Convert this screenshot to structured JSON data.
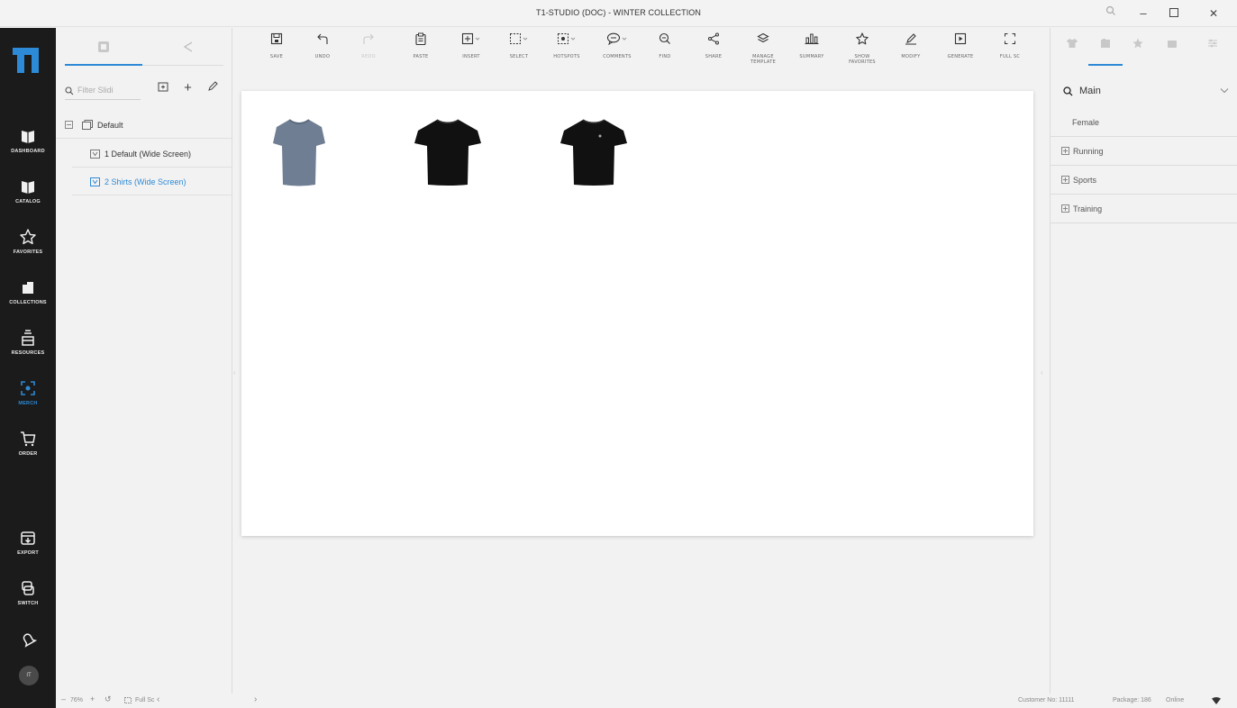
{
  "window": {
    "title": "T1-STUDIO (DOC) - WINTER COLLECTION",
    "controls": [
      "zoom-icon",
      "minimize",
      "maximize",
      "close"
    ]
  },
  "rail": {
    "items": [
      {
        "label": "DASHBOARD",
        "icon": "dashboard-icon"
      },
      {
        "label": "CATALOG",
        "icon": "catalog-icon"
      },
      {
        "label": "FAVORITES",
        "icon": "star-icon"
      },
      {
        "label": "COLLECTIONS",
        "icon": "collections-icon"
      },
      {
        "label": "RESOURCES",
        "icon": "resources-icon"
      },
      {
        "label": "MERCH",
        "icon": "merch-icon",
        "active": true
      },
      {
        "label": "ORDER",
        "icon": "cart-icon"
      },
      {
        "label": "EXPORT",
        "icon": "export-icon"
      },
      {
        "label": "SWITCH",
        "icon": "switch-icon"
      }
    ],
    "avatar": "IT"
  },
  "slides_panel": {
    "filter_placeholder": "Filter Slidi",
    "tree": [
      {
        "label": "Default",
        "level": 0
      },
      {
        "label": "1  Default (Wide Screen)",
        "level": 1
      },
      {
        "label": "2  Shirts (Wide Screen)",
        "level": 1,
        "selected": true
      }
    ]
  },
  "toolbar": [
    {
      "label": "SAVE",
      "icon": "save-icon"
    },
    {
      "label": "UNDO",
      "icon": "undo-icon"
    },
    {
      "label": "REDO",
      "icon": "redo-icon",
      "disabled": true
    },
    {
      "label": "PASTE",
      "icon": "paste-icon"
    },
    {
      "label": "INSERT",
      "icon": "insert-icon"
    },
    {
      "label": "SELECT",
      "icon": "select-icon"
    },
    {
      "label": "HOTSPOTS",
      "icon": "hotspots-icon"
    },
    {
      "label": "COMMENTS",
      "icon": "comments-icon"
    },
    {
      "label": "FIND",
      "icon": "find-icon"
    },
    {
      "label": "SHARE",
      "icon": "share-icon"
    },
    {
      "label": "MANAGE TEMPLATE",
      "icon": "template-icon"
    },
    {
      "label": "SUMMARY",
      "icon": "summary-icon"
    },
    {
      "label": "SHOW FAVORITES",
      "icon": "favorites-icon"
    },
    {
      "label": "MODIFY",
      "icon": "modify-icon"
    },
    {
      "label": "GENERATE",
      "icon": "generate-icon"
    },
    {
      "label": "FULL SC",
      "icon": "fullscreen-icon"
    }
  ],
  "canvas": {
    "products": [
      {
        "name": "grey-tshirt",
        "color": "#6f7e93"
      },
      {
        "name": "black-tshirt",
        "color": "#111111"
      },
      {
        "name": "black-tshirt-logo",
        "color": "#111111"
      }
    ]
  },
  "right_panel": {
    "search_value": "Main",
    "group_header": "Female",
    "categories": [
      "Running",
      "Sports",
      "Training"
    ]
  },
  "bottom_bar": {
    "zoom": "76%",
    "full_label": "Full Sc",
    "customer": "Customer No: 11111",
    "package": "Package: 186",
    "online": "Online"
  },
  "colors": {
    "accent": "#2d8ad6",
    "rail": "#1b1b1b"
  }
}
